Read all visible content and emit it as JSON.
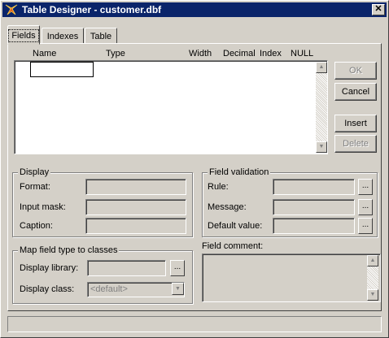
{
  "window": {
    "title": "Table Designer - customer.dbf",
    "close_glyph": "✕"
  },
  "tabs": [
    {
      "label": "Fields",
      "selected": true
    },
    {
      "label": "Indexes",
      "selected": false
    },
    {
      "label": "Table",
      "selected": false
    }
  ],
  "grid": {
    "columns": [
      "Name",
      "Type",
      "Width",
      "Decimal",
      "Index",
      "NULL"
    ]
  },
  "buttons": {
    "ok": "OK",
    "cancel": "Cancel",
    "insert": "Insert",
    "delete": "Delete"
  },
  "display_group": {
    "legend": "Display",
    "format_label": "Format:",
    "input_mask_label": "Input mask:",
    "caption_label": "Caption:"
  },
  "validation_group": {
    "legend": "Field validation",
    "rule_label": "Rule:",
    "message_label": "Message:",
    "default_value_label": "Default value:"
  },
  "map_group": {
    "legend": "Map field type to classes",
    "display_library_label": "Display library:",
    "display_class_label": "Display class:",
    "display_class_value": "<default>"
  },
  "field_comment": {
    "label": "Field comment:"
  },
  "icons": {
    "ellipsis": "...",
    "scroll_up": "▲",
    "scroll_down": "▼",
    "dropdown": "▼"
  }
}
